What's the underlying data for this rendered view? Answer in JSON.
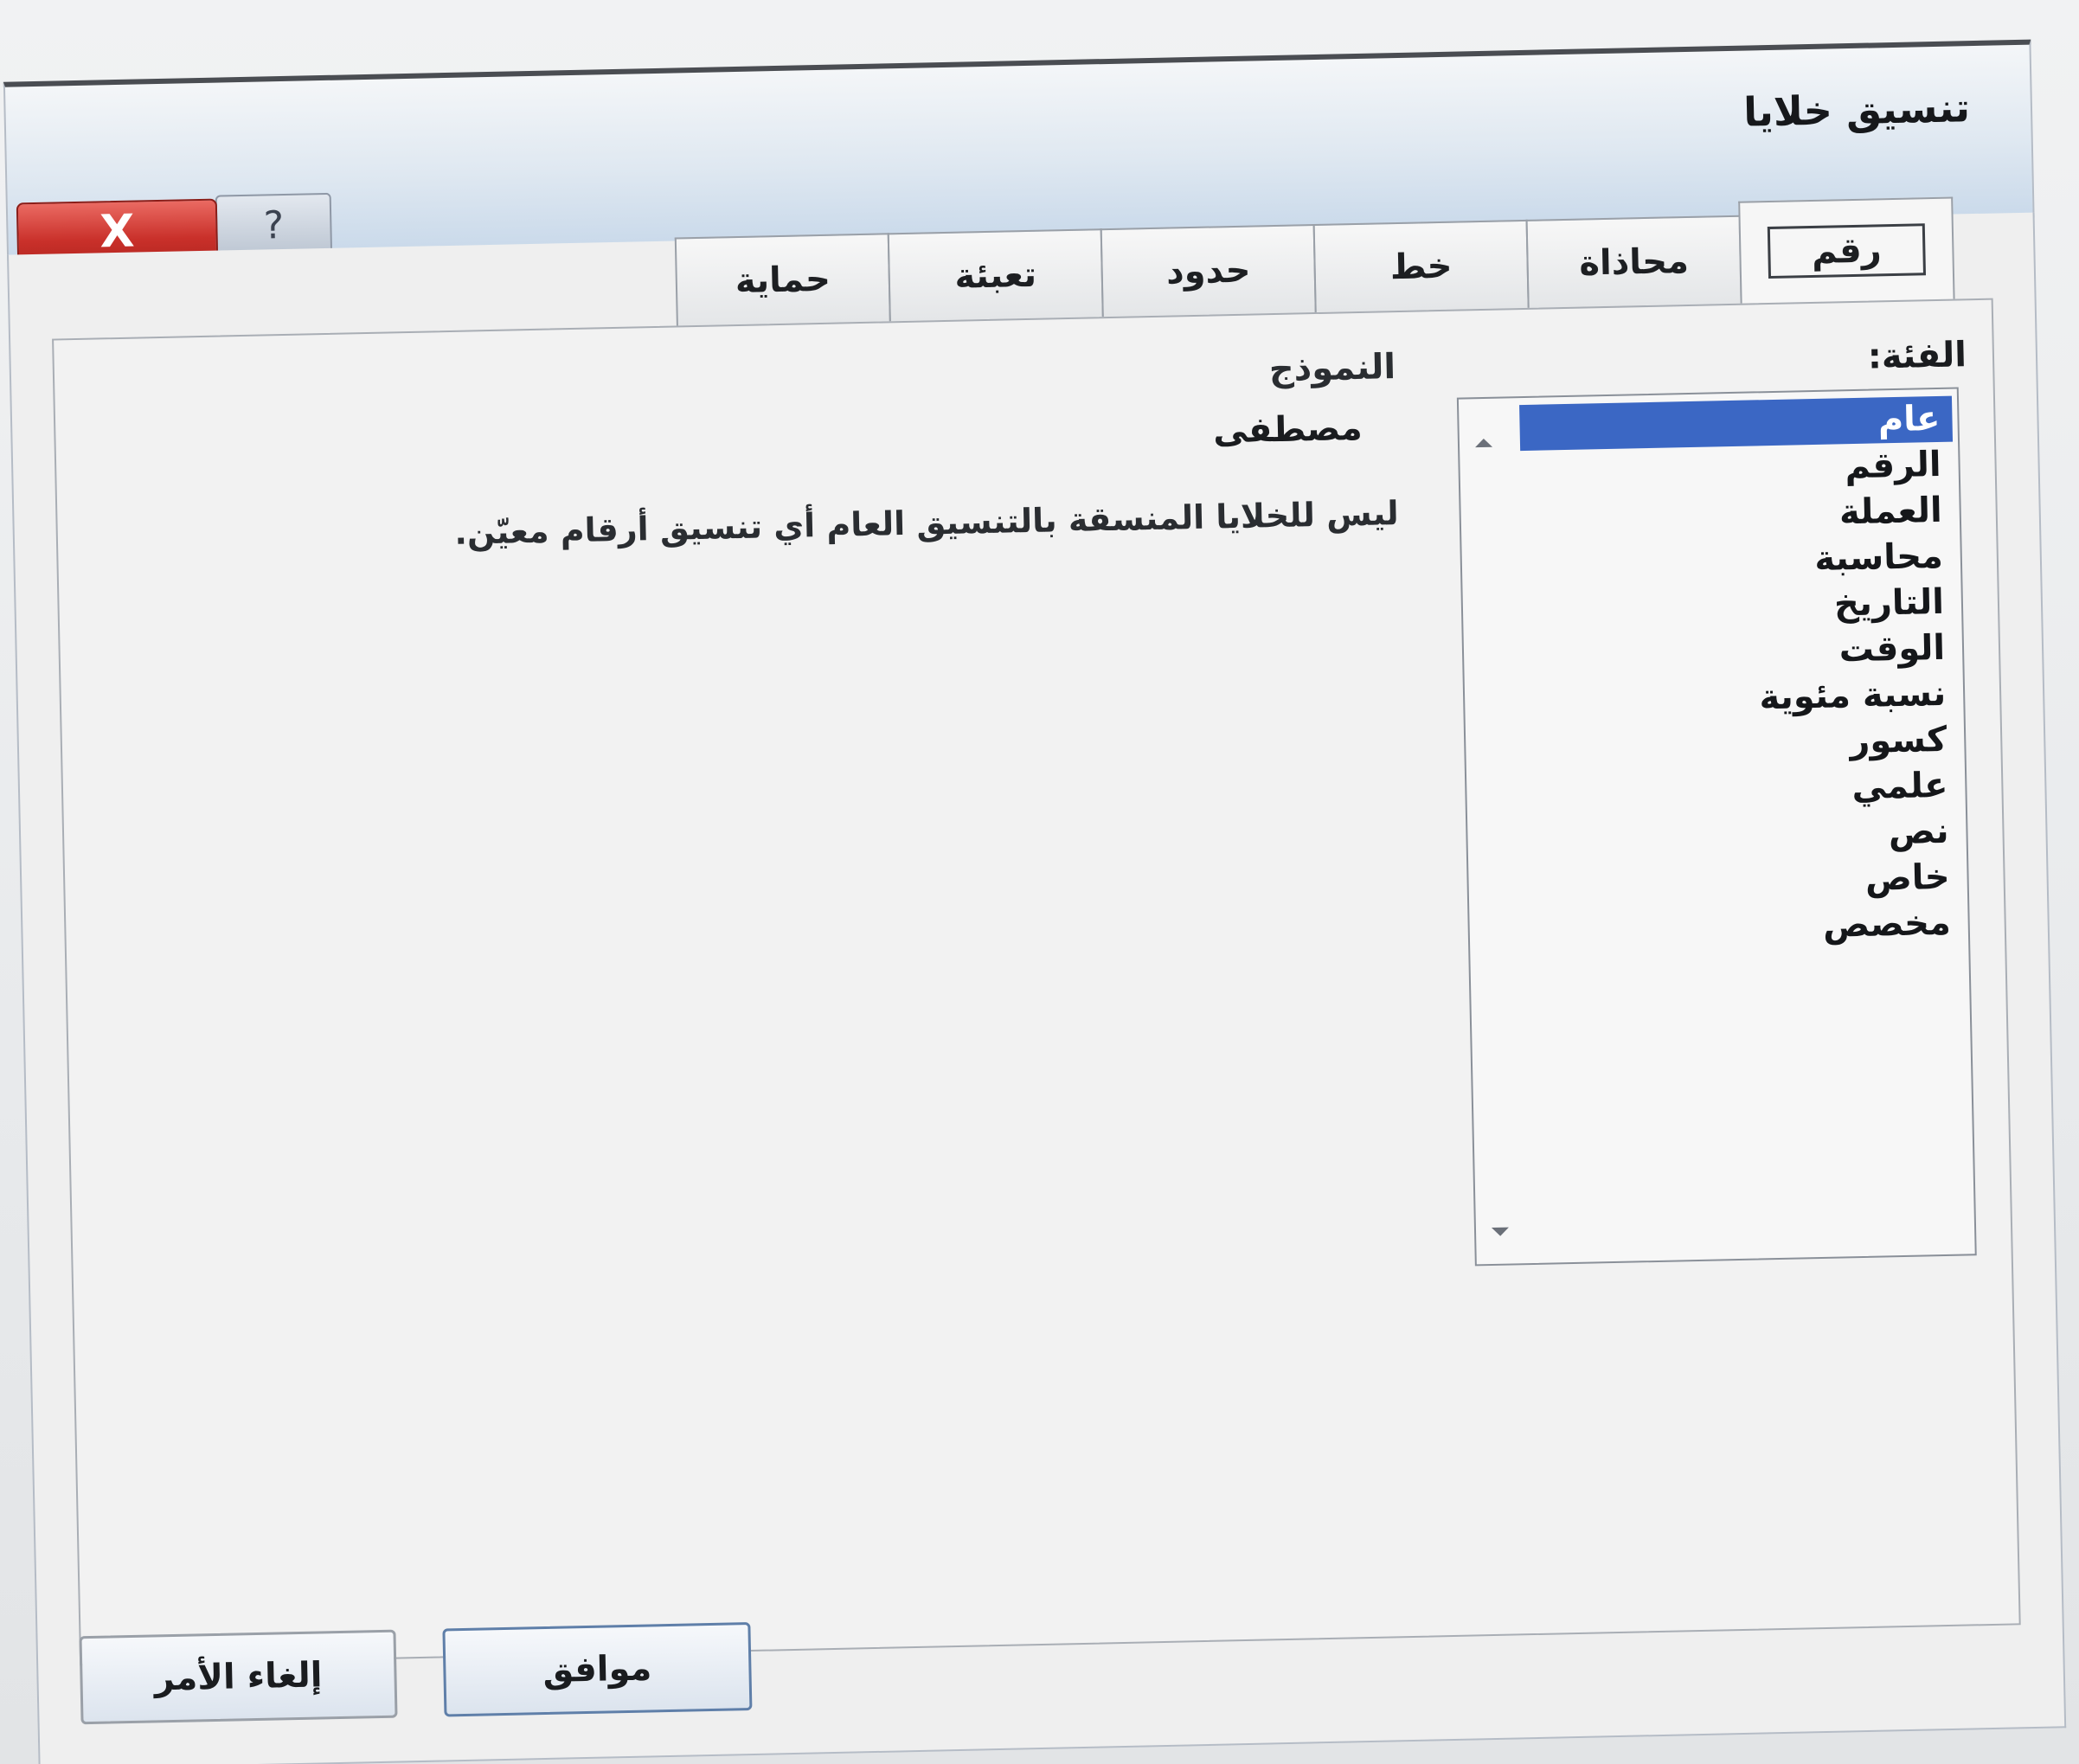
{
  "dialog": {
    "title": "تنسيق خلايا",
    "help_symbol": "?",
    "close_symbol": "X"
  },
  "tabs": [
    {
      "label": "رقم",
      "active": true
    },
    {
      "label": "محاذاة",
      "active": false
    },
    {
      "label": "خط",
      "active": false
    },
    {
      "label": "حدود",
      "active": false
    },
    {
      "label": "تعبئة",
      "active": false
    },
    {
      "label": "حماية",
      "active": false
    }
  ],
  "category": {
    "label": "الفئة:",
    "selected": "عام",
    "items": [
      "عام",
      "الرقم",
      "العملة",
      "محاسبة",
      "التاريخ",
      "الوقت",
      "نسبة مئوية",
      "كسور",
      "علمي",
      "نص",
      "خاص",
      "مخصص"
    ]
  },
  "sample": {
    "label": "النموذج",
    "value": "مصطفى"
  },
  "description": "ليس للخلايا المنسقة بالتنسيق العام أي تنسيق أرقام معيّن.",
  "buttons": {
    "ok": "موافق",
    "cancel": "إلغاء الأمر"
  },
  "colors": {
    "selection": "#3b67c4",
    "close_button": "#c9302a",
    "title_gradient_end": "#c9d9ea"
  }
}
